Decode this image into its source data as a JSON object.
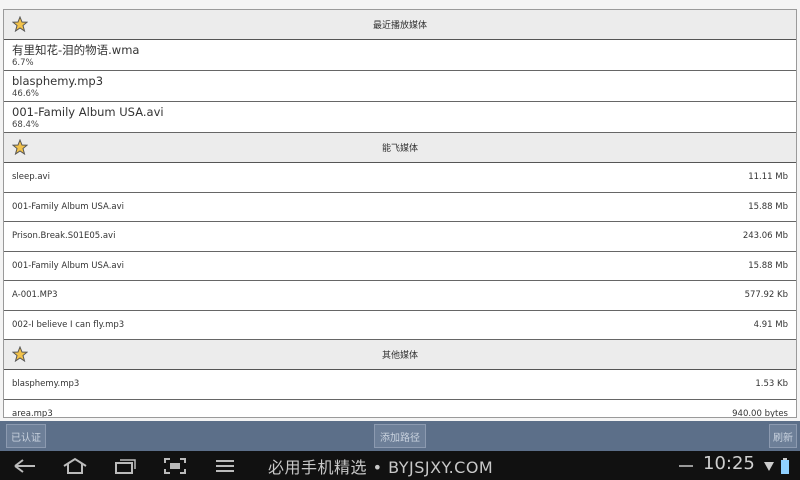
{
  "sections": {
    "recent": {
      "title": "最近播放媒体",
      "items": [
        {
          "name": "有里知花-泪的物语.wma",
          "progress": "6.7%"
        },
        {
          "name": "blasphemy.mp3",
          "progress": "46.6%"
        },
        {
          "name": "001-Family Album USA.avi",
          "progress": "68.4%"
        }
      ]
    },
    "cloud": {
      "title": "能飞媒体",
      "items": [
        {
          "name": "sleep.avi",
          "size": "11.11 Mb"
        },
        {
          "name": "001-Family Album USA.avi",
          "size": "15.88 Mb"
        },
        {
          "name": "Prison.Break.S01E05.avi",
          "size": "243.06 Mb"
        },
        {
          "name": "001-Family Album USA.avi",
          "size": "15.88 Mb"
        },
        {
          "name": "A-001.MP3",
          "size": "577.92 Kb"
        },
        {
          "name": "002-I believe I can fly.mp3",
          "size": "4.91 Mb"
        }
      ]
    },
    "other": {
      "title": "其他媒体",
      "items": [
        {
          "name": "blasphemy.mp3",
          "size": "1.53 Kb"
        },
        {
          "name": "area.mp3",
          "size": "940.00 bytes"
        }
      ]
    }
  },
  "actionbar": {
    "verified_label": "已认证",
    "add_path_label": "添加路径",
    "refresh_label": "刷新"
  },
  "statusbar": {
    "watermark": "必用手机精选 • BYJSJXY.COM",
    "time": "10:25"
  },
  "icons": {
    "section": "star-icon",
    "back": "back-icon",
    "home": "home-icon",
    "recents": "recent-apps-icon",
    "screenshot": "screenshot-icon",
    "menu": "menu-icon"
  },
  "colors": {
    "actionbar": "#5c6f89",
    "navbar": "#111111",
    "star": "#f2c24a"
  }
}
